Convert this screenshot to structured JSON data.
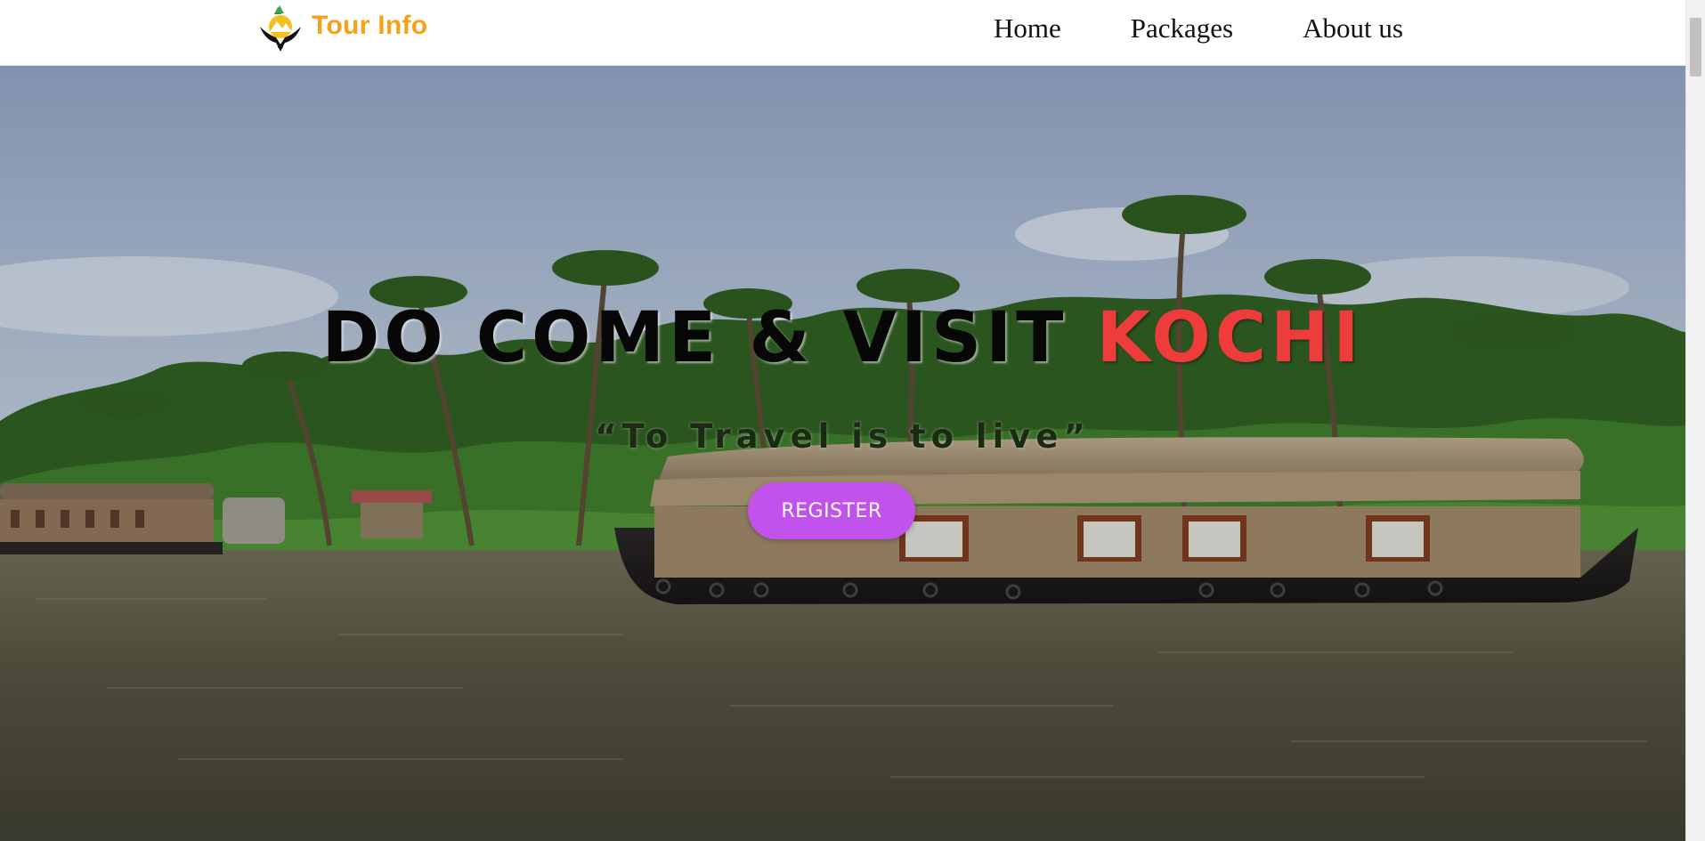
{
  "header": {
    "brand": "Tour Info",
    "logo_icon": "travel-globe-logo-icon",
    "nav": [
      {
        "label": "Home"
      },
      {
        "label": "Packages"
      },
      {
        "label": "About us"
      }
    ]
  },
  "hero": {
    "heading_main": "DO COME & VISIT ",
    "heading_highlight": "KOCHI",
    "tagline": "“To Travel is to live”",
    "cta_label": "REGISTER",
    "background": "kerala-backwaters-houseboat-photo"
  },
  "colors": {
    "brand": "#f5a21b",
    "highlight": "#ee3b3b",
    "cta": "#c152ec",
    "nav_text": "#111111"
  }
}
